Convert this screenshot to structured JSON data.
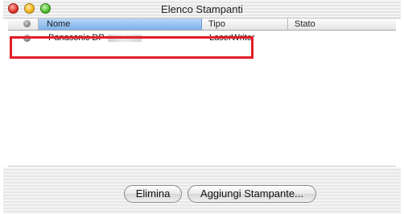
{
  "window": {
    "title": "Elenco Stampanti"
  },
  "columns": {
    "name": "Nome",
    "type": "Tipo",
    "status": "Stato"
  },
  "printers": [
    {
      "name": "Panasonic DP-",
      "type": "LaserWriter"
    }
  ],
  "buttons": {
    "delete": "Elimina",
    "add": "Aggiungi Stampante..."
  },
  "colors": {
    "highlight_box": "#e21e26",
    "header_sorted": "#7db1ea"
  }
}
